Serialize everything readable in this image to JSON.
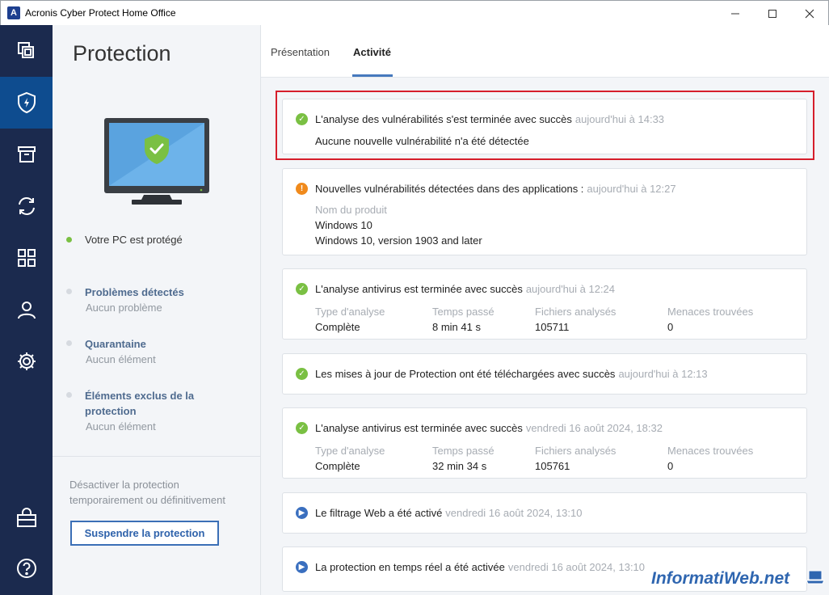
{
  "window": {
    "title": "Acronis Cyber Protect Home Office",
    "logo_letter": "A"
  },
  "side": {
    "title": "Protection",
    "status": "Votre PC est protégé",
    "items": [
      {
        "label": "Problèmes détectés",
        "sub": "Aucun problème"
      },
      {
        "label": "Quarantaine",
        "sub": "Aucun élément"
      },
      {
        "label": "Éléments exclus de la protection",
        "sub": "Aucun élément"
      }
    ],
    "note": "Désactiver la protection temporairement ou définitivement",
    "suspend_label": "Suspendre la protection"
  },
  "tabs": [
    {
      "label": "Présentation"
    },
    {
      "label": "Activité"
    }
  ],
  "activity": [
    {
      "status": "success",
      "title": "L'analyse des vulnérabilités s'est terminée avec succès",
      "time": "aujourd'hui à 14:33",
      "detail": "Aucune nouvelle vulnérabilité n'a été détectée"
    },
    {
      "status": "warning",
      "title": "Nouvelles vulnérabilités détectées dans des applications :",
      "time": "aujourd'hui à 12:27",
      "field_label": "Nom du produit",
      "values": [
        "Windows 10",
        "Windows 10, version 1903 and later"
      ]
    },
    {
      "status": "success",
      "title": "L'analyse antivirus est terminée avec succès",
      "time": "aujourd'hui à 12:24",
      "fields": [
        {
          "k": "Type d'analyse",
          "v": "Complète"
        },
        {
          "k": "Temps passé",
          "v": "8 min 41 s"
        },
        {
          "k": "Fichiers analysés",
          "v": "105711"
        },
        {
          "k": "Menaces trouvées",
          "v": "0"
        }
      ]
    },
    {
      "status": "success",
      "title": "Les mises à jour de Protection ont été téléchargées avec succès",
      "time": "aujourd'hui à 12:13"
    },
    {
      "status": "success",
      "title": "L'analyse antivirus est terminée avec succès",
      "time": "vendredi 16 août 2024, 18:32",
      "fields": [
        {
          "k": "Type d'analyse",
          "v": "Complète"
        },
        {
          "k": "Temps passé",
          "v": "32 min 34 s"
        },
        {
          "k": "Fichiers analysés",
          "v": "105761"
        },
        {
          "k": "Menaces trouvées",
          "v": "0"
        }
      ]
    },
    {
      "status": "info",
      "title": "Le filtrage Web a été activé",
      "time": "vendredi 16 août 2024, 13:10"
    },
    {
      "status": "info",
      "title": "La protection en temps réel a été activée",
      "time": "vendredi 16 août 2024, 13:10"
    }
  ],
  "watermark": "InformatiWeb.net",
  "icons": {
    "rail": [
      "backup-icon",
      "protection-shield-icon",
      "archive-icon",
      "sync-icon",
      "tools-icon",
      "account-icon",
      "settings-icon",
      "store-icon",
      "help-icon"
    ],
    "status": {
      "success": "check-icon",
      "warning": "exclamation-icon",
      "info": "play-icon"
    }
  },
  "colors": {
    "rail_bg": "#1b2a4e",
    "rail_active": "#0e4c8f",
    "success": "#7ac043",
    "warning": "#f08a1c",
    "info": "#3a6fbf",
    "highlight": "#d61e2b",
    "link": "#4f6b8f"
  }
}
